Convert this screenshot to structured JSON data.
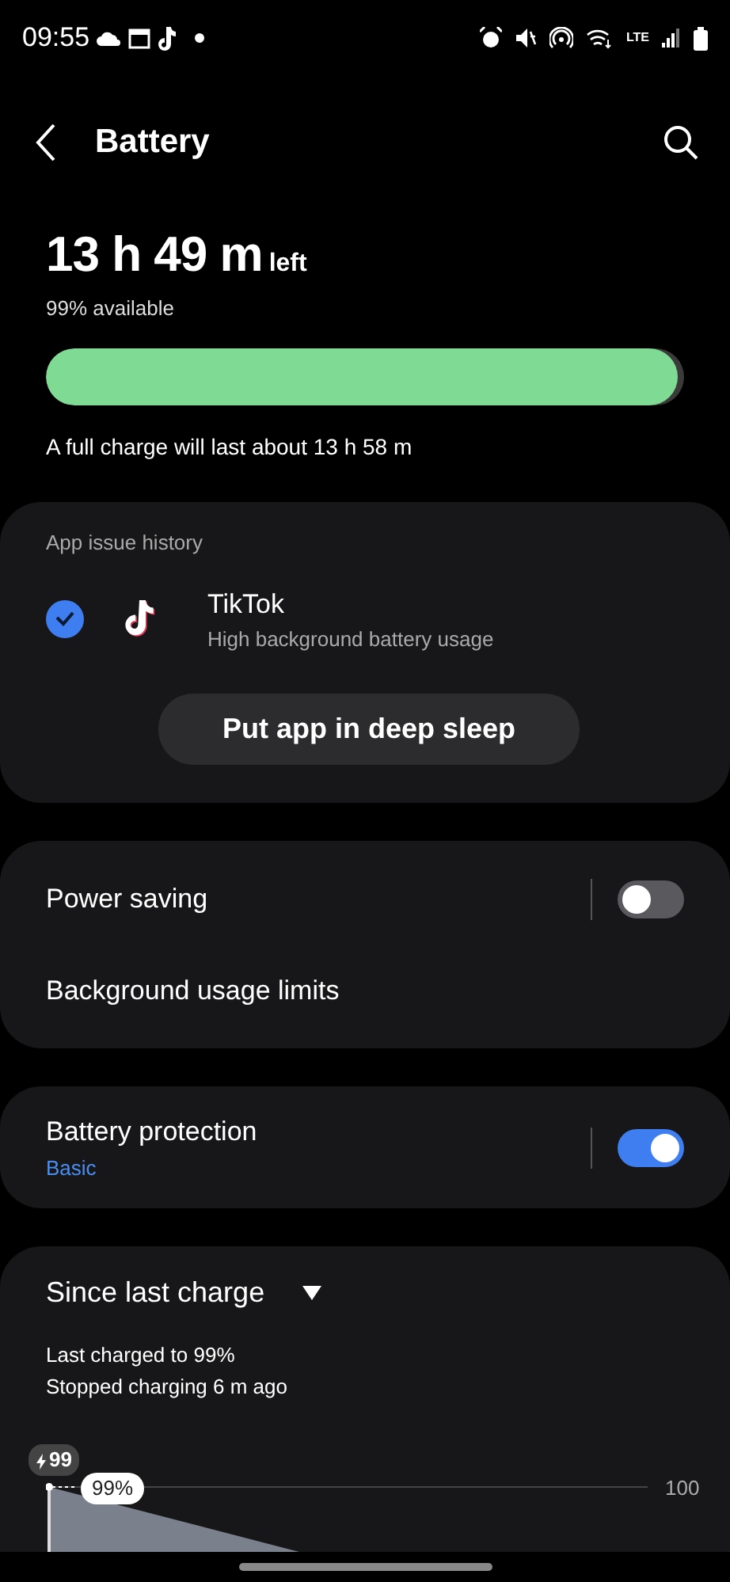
{
  "status_bar": {
    "time": "09:55",
    "lte_label": "LTE"
  },
  "header": {
    "title": "Battery"
  },
  "summary": {
    "time_left": "13 h 49 m",
    "left_label": "left",
    "available": "99% available",
    "level": 0.99,
    "full_charge": "A full charge will last about 13 h 58 m"
  },
  "app_issue_history": {
    "title": "App issue history",
    "apps": [
      {
        "name": "TikTok",
        "detail": "High background battery usage",
        "checked": true
      }
    ],
    "button": "Put app in deep sleep"
  },
  "settings": [
    {
      "label": "Power saving",
      "kind": "toggle",
      "on": false
    },
    {
      "label": "Background usage limits",
      "kind": "link"
    }
  ],
  "protection": {
    "label": "Battery protection",
    "value": "Basic",
    "on": true
  },
  "since_last_charge": {
    "title": "Since last charge",
    "lines": [
      "Last charged to 99%",
      "Stopped charging 6 m ago"
    ],
    "charge_tag": "99",
    "point_label": "99%",
    "axis_label": "100"
  }
}
